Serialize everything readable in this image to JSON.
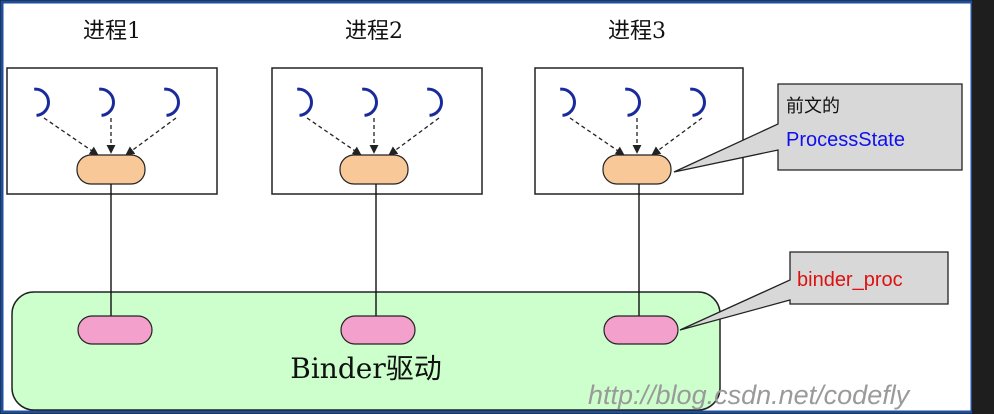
{
  "processes": [
    {
      "label": "进程1"
    },
    {
      "label": "进程2"
    },
    {
      "label": "进程3"
    }
  ],
  "driver": {
    "label": "Binder驱动"
  },
  "callouts": {
    "process_state": {
      "line1": "前文的",
      "line2": "ProcessState"
    },
    "binder_proc": {
      "text": "binder_proc"
    }
  },
  "watermark": "http://blog.csdn.net/codefly",
  "colors": {
    "frame_border": "#1f4e9c",
    "canvas_bg": "#ffffff",
    "driver_fill": "#ccffcc",
    "state_node_fill": "#f8c898",
    "proc_node_fill": "#f4a0cc",
    "thread_icon": "#1a2a9a",
    "callout_fill": "#d8d8d8"
  },
  "icons": [
    "thread-loop-icon"
  ]
}
